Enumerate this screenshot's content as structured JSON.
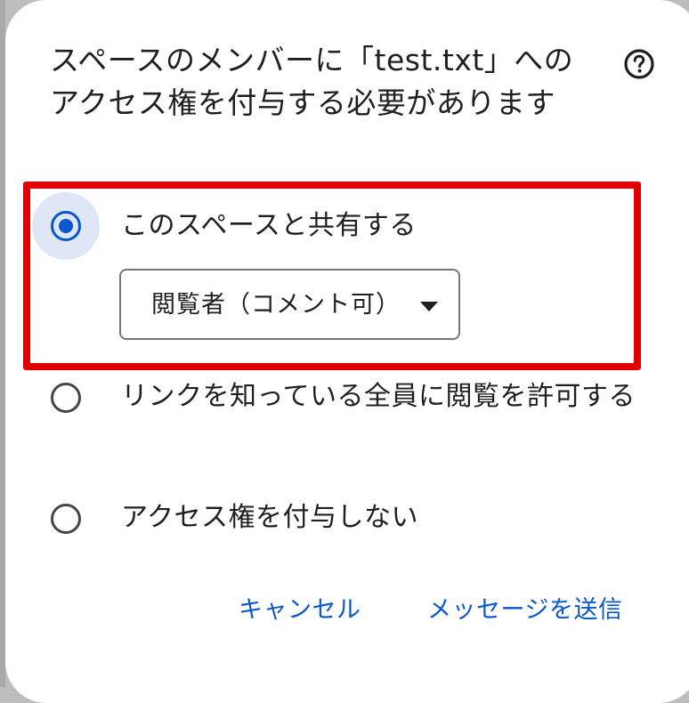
{
  "dialog": {
    "title": "スペースのメンバーに「test.txt」へのアクセス権を付与する必要があります",
    "help_icon": "help-circle-icon",
    "options": [
      {
        "label": "このスペースと共有する",
        "selected": true
      },
      {
        "label": "リンクを知っている全員に閲覧を許可する",
        "selected": false
      },
      {
        "label": "アクセス権を付与しない",
        "selected": false
      }
    ],
    "permission_select": {
      "value": "閲覧者（コメント可）",
      "icon": "dropdown-arrow-icon"
    },
    "actions": {
      "cancel_label": "キャンセル",
      "send_label": "メッセージを送信"
    }
  },
  "colors": {
    "accent": "#0b57d0",
    "highlight": "#e00000",
    "text": "#1f1f1f",
    "radio_halo": "#dfe7f7"
  }
}
